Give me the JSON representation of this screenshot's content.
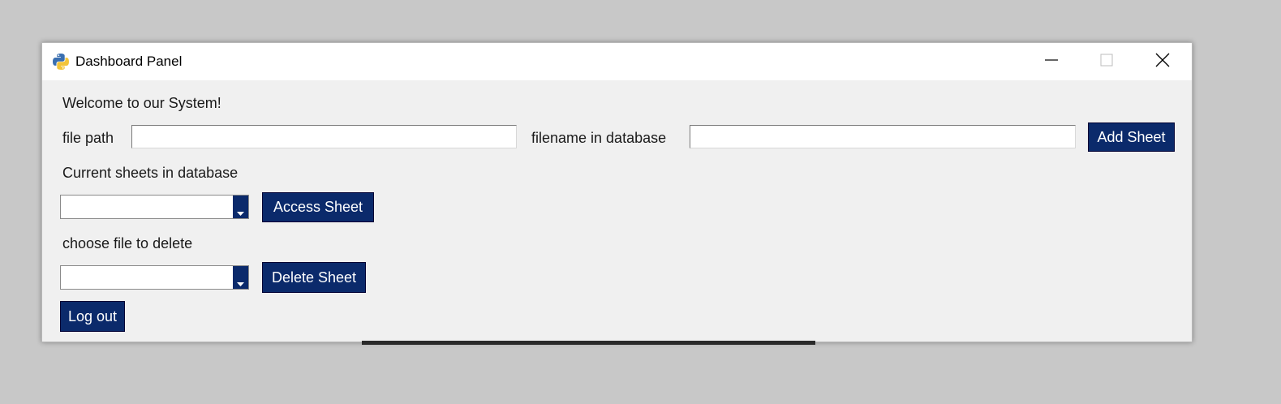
{
  "window": {
    "title": "Dashboard Panel",
    "icon": "python-icon",
    "controls": {
      "minimize_icon": "minimize-icon",
      "maximize_icon": "maximize-icon",
      "close_icon": "close-icon"
    }
  },
  "colors": {
    "button_bg": "#0b2a6b",
    "button_text": "#ffffff",
    "window_bg": "#f0f0f0",
    "desktop_bg": "#c8c8c8"
  },
  "main": {
    "welcome": "Welcome to our System!",
    "file_path_label": "file path",
    "file_path_value": "",
    "filename_label": "filename in database",
    "filename_value": "",
    "add_sheet_label": "Add Sheet",
    "current_sheets_label": "Current sheets in database",
    "current_sheets_selected": "",
    "access_sheet_label": "Access Sheet",
    "delete_label": "choose file to delete",
    "delete_selected": "",
    "delete_sheet_label": "Delete Sheet",
    "logout_label": "Log out"
  }
}
